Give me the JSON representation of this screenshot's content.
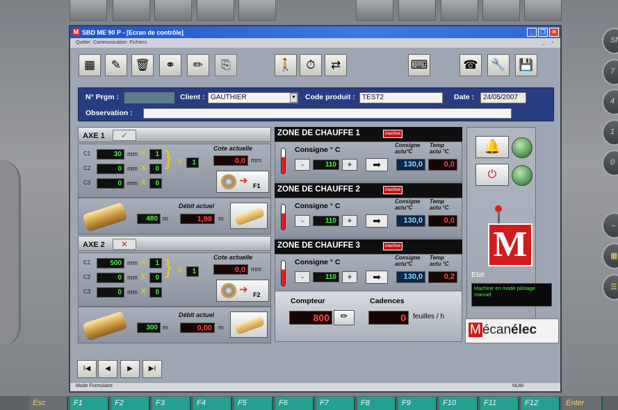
{
  "app": {
    "title": "SBD ME 90 P - [Ecran de contrôle]",
    "icon_letter": "M"
  },
  "window_controls": {
    "minimize": "_",
    "restore": "❐",
    "close": "✕"
  },
  "menu": {
    "items": [
      "Quitter",
      "Communication",
      "Fichiers"
    ],
    "right_controls": "_ ▫"
  },
  "toolbar": {
    "icons": [
      "calendar-icon",
      "screwdriver-icon",
      "trash-icon",
      "binoculars-icon",
      "pencil-icon",
      "copy-icon",
      "person-walking-icon",
      "timer-thermometer-icon",
      "network-transfer-icon",
      "keyboard-icon",
      "telephone-icon",
      "wrench-icon",
      "save-disk-icon"
    ]
  },
  "info": {
    "prgm_label": "N° Prgm :",
    "prgm_value": "",
    "client_label": "Client :",
    "client_value": "GAUTHIER",
    "code_label": "Code produit :",
    "code_value": "TEST2",
    "date_label": "Date :",
    "date_value": "24/05/2007",
    "observation_label": "Observation :",
    "observation_value": ""
  },
  "axe1": {
    "title": "AXE 1",
    "status_mark": "✓",
    "rows": [
      {
        "label": "C1",
        "value": "30",
        "unit": "mm",
        "x": "X",
        "mult": "1"
      },
      {
        "label": "C2",
        "value": "0",
        "unit": "mm",
        "x": "X",
        "mult": "0"
      },
      {
        "label": "C3",
        "value": "0",
        "unit": "mm",
        "x": "X",
        "mult": "0"
      }
    ],
    "total_x": "X",
    "total_mult": "1",
    "cote_label": "Cote actuelle",
    "cote_value": "0,0",
    "cote_unit": "mm",
    "fkey": "F1",
    "length_value": "480",
    "length_unit": "m",
    "debit_label": "Débit actuel",
    "debit_value": "1,98",
    "debit_unit": "m"
  },
  "axe2": {
    "title": "AXE 2",
    "status_mark": "✕",
    "rows": [
      {
        "label": "C1",
        "value": "500",
        "unit": "mm",
        "x": "X",
        "mult": "1"
      },
      {
        "label": "C2",
        "value": "0",
        "unit": "mm",
        "x": "X",
        "mult": "0"
      },
      {
        "label": "C3",
        "value": "0",
        "unit": "mm",
        "x": "X",
        "mult": "0"
      }
    ],
    "total_x": "X",
    "total_mult": "1",
    "cote_label": "Cote actuelle",
    "cote_value": "0,0",
    "cote_unit": "mm",
    "fkey": "F2",
    "length_value": "300",
    "length_unit": "m",
    "debit_label": "Débit actuel",
    "debit_value": "0,00",
    "debit_unit": "m"
  },
  "zones": [
    {
      "title": "ZONE DE CHAUFFE  1",
      "badge": "inactive",
      "consigne_label": "Consigne  ° C",
      "minus": "-",
      "value": "110",
      "plus": "+",
      "arrow": "➡",
      "actu_label": "Consigne actu°C",
      "temp_label": "Temp actu °C",
      "consigne_actu": "130,0",
      "temp_actu": "0,0"
    },
    {
      "title": "ZONE DE CHAUFFE  2",
      "badge": "inactive",
      "consigne_label": "Consigne  ° C",
      "minus": "-",
      "value": "110",
      "plus": "+",
      "arrow": "➡",
      "actu_label": "Consigne actu°C",
      "temp_label": "Temp actu °C",
      "consigne_actu": "130,0",
      "temp_actu": "0,0"
    },
    {
      "title": "ZONE DE CHAUFFE  3",
      "badge": "inactive",
      "consigne_label": "Consigne  ° C",
      "minus": "-",
      "value": "110",
      "plus": "+",
      "arrow": "➡",
      "actu_label": "Consigne actu°C",
      "temp_label": "Temp actu °C",
      "consigne_actu": "130,0",
      "temp_actu": "0,2"
    }
  ],
  "counter": {
    "compteur_label": "Compteur",
    "compteur_value": "800",
    "cadences_label": "Cadences",
    "cadences_value": "0",
    "cadences_unit": "feuilles / h"
  },
  "status_panel": {
    "etat_label": "Etat",
    "etat_message": "Machine en mode pilotage manuel",
    "logo_letter": "M",
    "brand_first": "M",
    "brand_rest": "écan",
    "brand_bold": "élec"
  },
  "nav": {
    "first": "I◀",
    "prev": "◀",
    "next": "▶",
    "last": "▶I"
  },
  "statusbar": {
    "mode": "Mode Formulaire",
    "num": "NUM"
  },
  "bezel": {
    "fkeys": [
      "Esc",
      "F1",
      "F2",
      "F3",
      "F4",
      "F5",
      "F6",
      "F7",
      "F8",
      "F9",
      "F10",
      "F11",
      "F12",
      "Enter"
    ],
    "right_keys": [
      "Shi",
      "7",
      "4",
      "1",
      "0"
    ]
  },
  "colors": {
    "titlebar": "#1f52c8",
    "info_bar": "#283c7f",
    "led_green": "#4df04d",
    "led_red": "#ff4545",
    "accent_red": "#d01c1c"
  }
}
